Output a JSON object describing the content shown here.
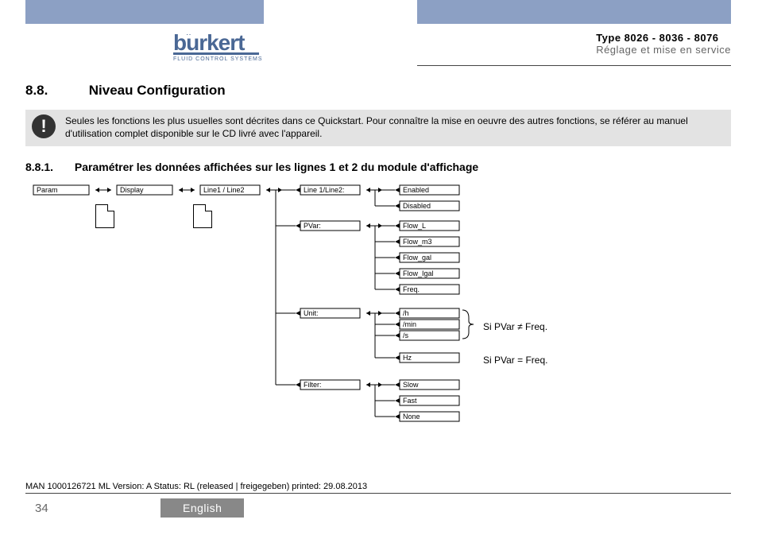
{
  "header": {
    "logo_brand": "burkert",
    "logo_tagline": "FLUID CONTROL SYSTEMS",
    "doc_type": "Type 8026 - 8036 - 8076",
    "doc_sub": "Réglage et mise en service"
  },
  "section": {
    "num": "8.8.",
    "title": "Niveau Configuration"
  },
  "note": {
    "text": "Seules les fonctions les plus usuelles sont décrites dans ce Quickstart. Pour connaître la mise en oeuvre des autres fonctions, se référer au manuel d'utilisation complet disponible sur le CD livré avec l'appareil."
  },
  "subsection": {
    "num": "8.8.1.",
    "title": "Paramétrer les données affichées sur les lignes 1 et 2 du module d'affichage"
  },
  "diagram": {
    "row_top": [
      "Param",
      "Display",
      "Line1 / Line2"
    ],
    "col_right": {
      "line12": {
        "label": "Line 1/Line2:",
        "opts": [
          "Enabled",
          "Disabled"
        ]
      },
      "pvar": {
        "label": "PVar:",
        "opts": [
          "Flow_L",
          "Flow_m3",
          "Flow_gal",
          "Flow_Igal",
          "Freq."
        ]
      },
      "unit": {
        "label": "Unit:",
        "opts": [
          "/h",
          "/min",
          "/s",
          "Hz"
        ]
      },
      "filter": {
        "label": "Filter:",
        "opts": [
          "Slow",
          "Fast",
          "None"
        ]
      }
    }
  },
  "annotations": {
    "cond_ne": "Si PVar ≠ Freq.",
    "cond_eq": "Si PVar = Freq."
  },
  "footer": {
    "meta": "MAN 1000126721 ML Version: A Status: RL (released | freigegeben) printed: 29.08.2013",
    "page_num": "34",
    "lang": "English"
  }
}
